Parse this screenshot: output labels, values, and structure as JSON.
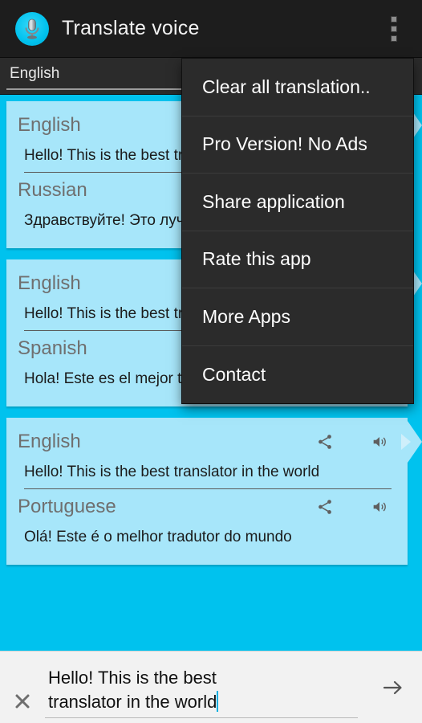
{
  "actionbar": {
    "title": "Translate voice",
    "app_icon": "microphone-icon",
    "overflow_icon": "overflow-menu-icon"
  },
  "spinner": {
    "selected_language": "English"
  },
  "cards": [
    {
      "source": {
        "language": "English",
        "text": "Hello! This is the best translator in the world",
        "share_icon": "share-icon",
        "speak_icon": "speaker-icon"
      },
      "target": {
        "language": "Russian",
        "text": "Здравствуйте! Это лучший переводчик в мире",
        "share_icon": "share-icon",
        "speak_icon": "speaker-icon"
      }
    },
    {
      "source": {
        "language": "English",
        "text": "Hello! This is the best translator in the world",
        "share_icon": "share-icon",
        "speak_icon": "speaker-icon"
      },
      "target": {
        "language": "Spanish",
        "text": "Hola! Este es el mejor traductor en el mundo",
        "share_icon": "share-icon",
        "speak_icon": "speaker-icon"
      }
    },
    {
      "source": {
        "language": "English",
        "text": "Hello! This is the best translator in the world",
        "share_icon": "share-icon",
        "speak_icon": "speaker-icon"
      },
      "target": {
        "language": "Portuguese",
        "text": "Olá! Este é o melhor tradutor do mundo",
        "share_icon": "share-icon",
        "speak_icon": "speaker-icon"
      }
    }
  ],
  "menu": {
    "items": [
      {
        "label": "Clear all translation.."
      },
      {
        "label": "Pro Version! No Ads"
      },
      {
        "label": "Share application"
      },
      {
        "label": "Rate this app"
      },
      {
        "label": "More Apps"
      },
      {
        "label": "Contact"
      }
    ]
  },
  "input": {
    "clear_icon": "close-x-icon",
    "value_line1": "Hello! This is the best",
    "value_line2": "translator in the world",
    "placeholder": "",
    "send_icon": "arrow-right-icon"
  },
  "colors": {
    "background": "#00c2ee",
    "card": "#a7e6fa",
    "actionbar": "#1d1d1d",
    "menu": "#2b2b2b",
    "caret": "#00aee0",
    "bottom_bar": "#f2f2f2"
  }
}
